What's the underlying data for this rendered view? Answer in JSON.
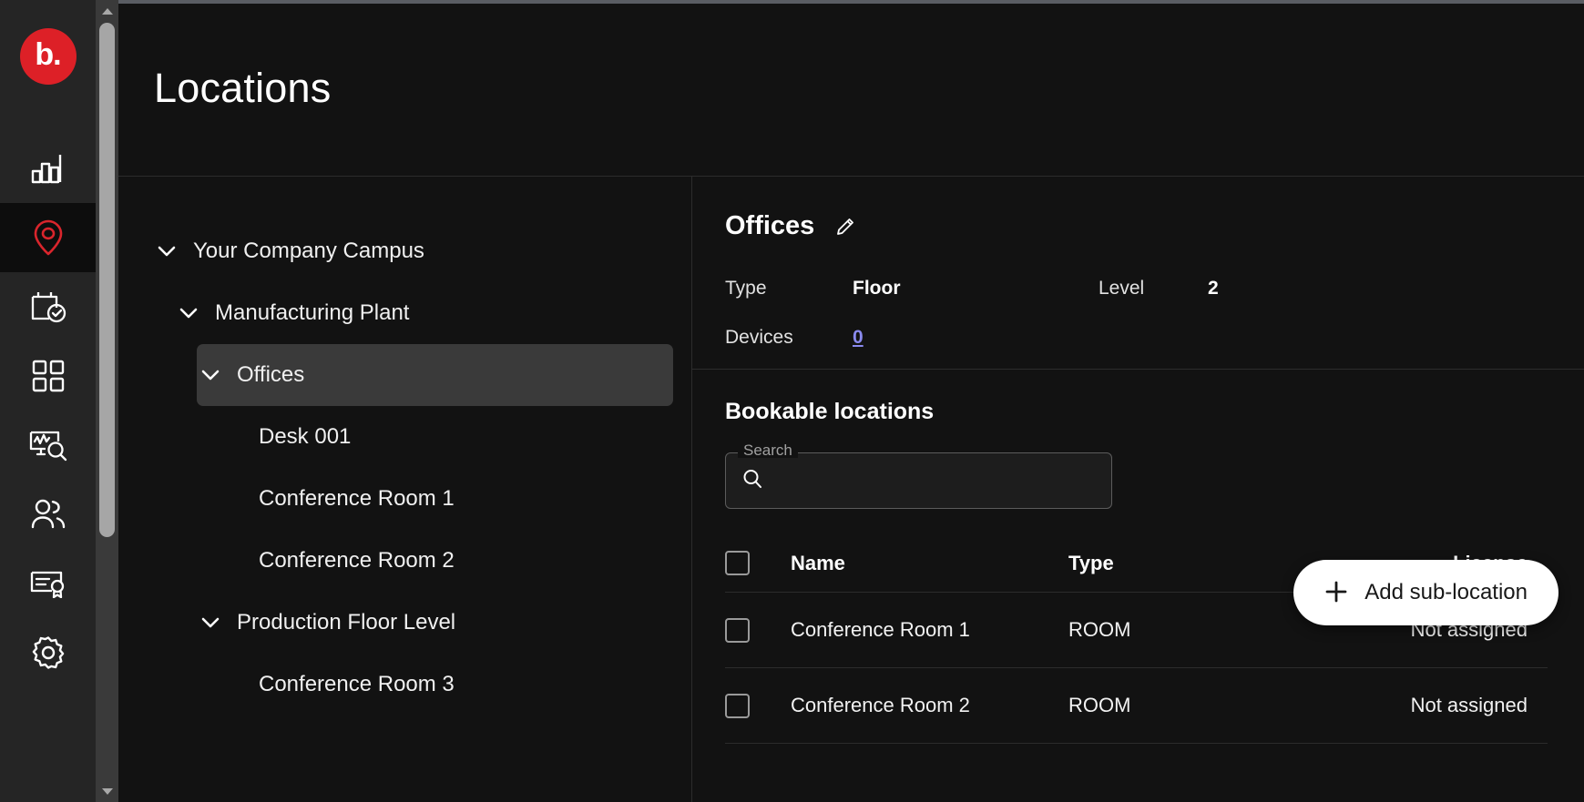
{
  "brand": {
    "logo_text": "b.",
    "logo_color": "#dd2027"
  },
  "page": {
    "title": "Locations"
  },
  "sidebar": {
    "items": [
      {
        "name": "dashboard",
        "icon": "bar-chart-icon",
        "active": false
      },
      {
        "name": "locations",
        "icon": "location-pin-icon",
        "active": true
      },
      {
        "name": "bookings",
        "icon": "calendar-check-icon",
        "active": false
      },
      {
        "name": "apps",
        "icon": "grid-apps-icon",
        "active": false
      },
      {
        "name": "analytics",
        "icon": "monitor-search-icon",
        "active": false
      },
      {
        "name": "users",
        "icon": "people-icon",
        "active": false
      },
      {
        "name": "licenses",
        "icon": "certificate-icon",
        "active": false
      },
      {
        "name": "settings",
        "icon": "gear-icon",
        "active": false
      }
    ]
  },
  "tree": {
    "nodes": [
      {
        "label": "Your Company Campus",
        "level": 0,
        "expandable": true,
        "expanded": true,
        "selected": false
      },
      {
        "label": "Manufacturing Plant",
        "level": 1,
        "expandable": true,
        "expanded": true,
        "selected": false
      },
      {
        "label": "Offices",
        "level": 2,
        "expandable": true,
        "expanded": true,
        "selected": true
      },
      {
        "label": "Desk 001",
        "level": 3,
        "expandable": false,
        "expanded": false,
        "selected": false
      },
      {
        "label": "Conference Room 1",
        "level": 3,
        "expandable": false,
        "expanded": false,
        "selected": false
      },
      {
        "label": "Conference Room 2",
        "level": 3,
        "expandable": false,
        "expanded": false,
        "selected": false
      },
      {
        "label": "Production Floor Level",
        "level": 2,
        "expandable": true,
        "expanded": true,
        "selected": false
      },
      {
        "label": "Conference Room 3",
        "level": 3,
        "expandable": false,
        "expanded": false,
        "selected": false
      }
    ]
  },
  "detail": {
    "title": "Offices",
    "edit_icon": "pencil-icon",
    "meta": {
      "type_label": "Type",
      "type_value": "Floor",
      "level_label": "Level",
      "level_value": "2",
      "devices_label": "Devices",
      "devices_value": "0",
      "devices_link_color": "#8a8aee"
    },
    "bookable": {
      "section_title": "Bookable locations",
      "search": {
        "label": "Search",
        "value": "",
        "placeholder": "",
        "icon": "search-icon"
      },
      "columns": [
        "Name",
        "Type",
        "License"
      ],
      "rows": [
        {
          "name": "Conference Room 1",
          "type": "ROOM",
          "license": "Not assigned",
          "checked": false
        },
        {
          "name": "Conference Room 2",
          "type": "ROOM",
          "license": "Not assigned",
          "checked": false
        }
      ]
    }
  },
  "fab": {
    "label": "Add sub-location",
    "icon": "plus-icon"
  },
  "scrollbar": {
    "up_icon": "chevron-up-icon",
    "down_icon": "chevron-down-icon"
  }
}
